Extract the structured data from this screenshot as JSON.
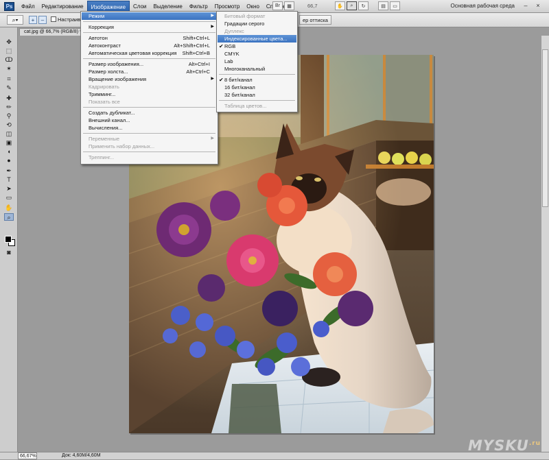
{
  "menubar": {
    "app_icon": "Ps",
    "items": [
      "Файл",
      "Редактирование",
      "Изображение",
      "Слои",
      "Выделение",
      "Фильтр",
      "Просмотр",
      "Окно",
      "Справка"
    ],
    "zoom_value": "66,7",
    "workspace": "Основная рабочая среда",
    "minimize": "–",
    "close": "×"
  },
  "options": {
    "tool_icon": "magnifier-icon",
    "checkbox_label": "Настраивать",
    "button_right": "ер оттиска"
  },
  "document": {
    "tab_title": "cat.jpg @ 66,7% (RGB/8) *",
    "tab_close": "×"
  },
  "status": {
    "zoom": "66,67%",
    "doc_size": "Док: 4,60M/4,60M"
  },
  "image_menu": {
    "items": [
      {
        "label": "Режим",
        "shortcut": "",
        "submenu": true,
        "highlighted": true,
        "disabled": false
      },
      {
        "sep": true
      },
      {
        "label": "Коррекция",
        "shortcut": "",
        "submenu": true,
        "disabled": false
      },
      {
        "sep": true
      },
      {
        "label": "Автотон",
        "shortcut": "Shift+Ctrl+L",
        "disabled": false
      },
      {
        "label": "Автоконтраст",
        "shortcut": "Alt+Shift+Ctrl+L",
        "disabled": false
      },
      {
        "label": "Автоматическая цветовая коррекция",
        "shortcut": "Shift+Ctrl+B",
        "disabled": false
      },
      {
        "sep": true
      },
      {
        "label": "Размер изображения...",
        "shortcut": "Alt+Ctrl+I",
        "disabled": false
      },
      {
        "label": "Размер холста...",
        "shortcut": "Alt+Ctrl+C",
        "disabled": false
      },
      {
        "label": "Вращение изображения",
        "shortcut": "",
        "submenu": true,
        "disabled": false
      },
      {
        "label": "Кадрировать",
        "shortcut": "",
        "disabled": true
      },
      {
        "label": "Тримминг...",
        "shortcut": "",
        "disabled": false
      },
      {
        "label": "Показать все",
        "shortcut": "",
        "disabled": true
      },
      {
        "sep": true
      },
      {
        "label": "Создать дубликат...",
        "shortcut": "",
        "disabled": false
      },
      {
        "label": "Внешний канал...",
        "shortcut": "",
        "disabled": false
      },
      {
        "label": "Вычисления...",
        "shortcut": "",
        "disabled": false
      },
      {
        "sep": true
      },
      {
        "label": "Переменные",
        "shortcut": "",
        "submenu": true,
        "disabled": true
      },
      {
        "label": "Применить набор данных...",
        "shortcut": "",
        "disabled": true
      },
      {
        "sep": true
      },
      {
        "label": "Треппинг...",
        "shortcut": "",
        "disabled": true
      }
    ]
  },
  "mode_menu": {
    "items": [
      {
        "label": "Битовый формат",
        "disabled": true
      },
      {
        "label": "Градации серого",
        "disabled": false
      },
      {
        "label": "Дуплекс",
        "disabled": true
      },
      {
        "label": "Индексированные цвета...",
        "disabled": false,
        "highlighted": true
      },
      {
        "label": "RGB",
        "disabled": false,
        "checked": true
      },
      {
        "label": "CMYK",
        "disabled": false
      },
      {
        "label": "Lab",
        "disabled": false
      },
      {
        "label": "Многоканальный",
        "disabled": false
      },
      {
        "sep": true
      },
      {
        "label": "8 бит/канал",
        "disabled": false,
        "checked": true
      },
      {
        "label": "16 бит/канал",
        "disabled": false
      },
      {
        "label": "32 бит/канал",
        "disabled": false
      },
      {
        "sep": true
      },
      {
        "label": "Таблица цветов...",
        "disabled": true
      }
    ]
  },
  "watermark": {
    "text": "MYSKU",
    "suffix": ".ru"
  },
  "colors": {
    "menu_highlight": "#3b73c0",
    "foreground": "#000000",
    "background": "#ffffff"
  }
}
